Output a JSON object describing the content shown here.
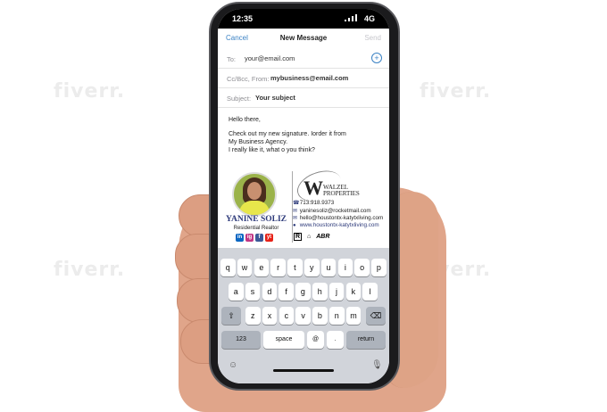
{
  "watermark": "fiverr.",
  "status_bar": {
    "time": "12:35",
    "network": "4G"
  },
  "nav": {
    "cancel": "Cancel",
    "title": "New Message",
    "send": "Send"
  },
  "fields": {
    "to_label": "To:",
    "to_value": "your@email.com",
    "cc_label": "Cc/Bcc, From:",
    "cc_value": "mybusiness@email.com",
    "subject_label": "Subject:",
    "subject_value": "Your subject"
  },
  "body": {
    "greeting": "Hello there,",
    "line1": "Check out my new signature. Iorder it from",
    "line2": "My Business Agency.",
    "line3": "I really like it, what o you think?"
  },
  "signature": {
    "name": "YANINE SOLIZ",
    "role": "Residential Realtor",
    "social": [
      "in",
      "ig",
      "f",
      "yt"
    ],
    "logo_mark": "W",
    "logo_line1": "WALZEL",
    "logo_line2": "PROPERTIES",
    "phone": "713.918.9373",
    "email1": "yaninesoliz@rocketmail.com",
    "email2": "hello@houstontx-katytxliving.com",
    "website": "www.houstontx-katytxliving.com",
    "badges": [
      "R",
      "⌂",
      "ABR"
    ]
  },
  "keyboard": {
    "row1": [
      "q",
      "w",
      "e",
      "r",
      "t",
      "y",
      "u",
      "i",
      "o",
      "p"
    ],
    "row2": [
      "a",
      "s",
      "d",
      "f",
      "g",
      "h",
      "j",
      "k",
      "l"
    ],
    "row3": [
      "z",
      "x",
      "c",
      "v",
      "b",
      "n",
      "m"
    ],
    "numbers": "123",
    "space": "space",
    "at": "@",
    "dot": ".",
    "return": "return"
  },
  "colors": {
    "accent": "#3b82c4",
    "brand_navy": "#2d3a7a",
    "linkedin": "#0a66c2",
    "instagram": "#c13584",
    "facebook": "#3b5998",
    "youtube": "#e62117"
  },
  "icons": [
    "shift-icon",
    "backspace-icon",
    "emoji-icon",
    "microphone-icon",
    "add-contact-icon"
  ]
}
